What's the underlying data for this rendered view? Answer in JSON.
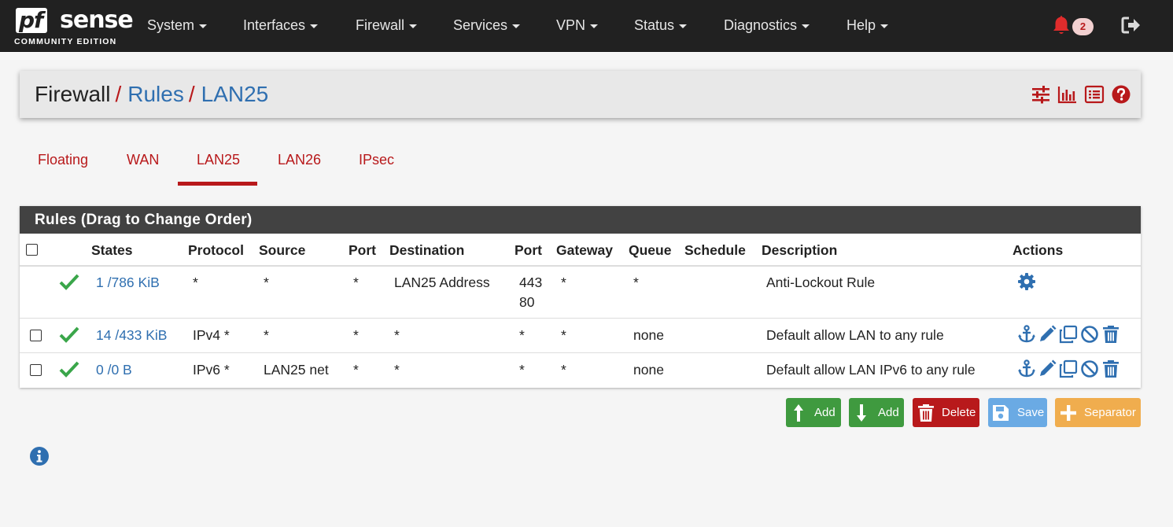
{
  "brand": {
    "logo_pf": "pf",
    "logo_sense": "sense",
    "edition": "COMMUNITY EDITION"
  },
  "nav": {
    "items": [
      {
        "label": "System"
      },
      {
        "label": "Interfaces"
      },
      {
        "label": "Firewall"
      },
      {
        "label": "Services"
      },
      {
        "label": "VPN"
      },
      {
        "label": "Status"
      },
      {
        "label": "Diagnostics"
      },
      {
        "label": "Help"
      }
    ],
    "notifications_count": "2",
    "icons": {
      "bell": "bell-icon",
      "logout": "sign-out-icon"
    },
    "colors": {
      "bar": "#212121",
      "alert": "#e02c2c"
    }
  },
  "breadcrumb": {
    "root": "Firewall",
    "sep": "/",
    "level1": "Rules",
    "level2": "LAN25",
    "icons": [
      "sliders-icon",
      "bar-chart-icon",
      "list-icon",
      "help-icon"
    ]
  },
  "tabs": [
    {
      "label": "Floating"
    },
    {
      "label": "WAN"
    },
    {
      "label": "LAN25",
      "active": true
    },
    {
      "label": "LAN26"
    },
    {
      "label": "IPsec"
    }
  ],
  "rules": {
    "panel_title": "Rules (Drag to Change Order)",
    "columns": [
      "States",
      "Protocol",
      "Source",
      "Port",
      "Destination",
      "Port",
      "Gateway",
      "Queue",
      "Schedule",
      "Description",
      "Actions"
    ],
    "rows": [
      {
        "states": "1 /786 KiB",
        "protocol": "*",
        "source": "*",
        "source_port": "*",
        "destination": "LAN25 Address",
        "dest_port_1": "443",
        "dest_port_2": "80",
        "gateway": "*",
        "queue": "*",
        "schedule": "",
        "description": "Anti-Lockout Rule",
        "actions": [
          "gear-icon"
        ]
      },
      {
        "states": "14 /433 KiB",
        "protocol": "IPv4 *",
        "source": "*",
        "source_port": "*",
        "destination": "*",
        "dest_port_1": "*",
        "gateway": "*",
        "queue": "none",
        "schedule": "",
        "description": "Default allow LAN to any rule",
        "actions": [
          "anchor-icon",
          "pencil-icon",
          "copy-icon",
          "ban-icon",
          "trash-icon"
        ]
      },
      {
        "states": "0 /0 B",
        "protocol": "IPv6 *",
        "source": "LAN25 net",
        "source_port": "*",
        "destination": "*",
        "dest_port_1": "*",
        "gateway": "*",
        "queue": "none",
        "schedule": "",
        "description": "Default allow LAN IPv6 to any rule",
        "actions": [
          "anchor-icon",
          "pencil-icon",
          "copy-icon",
          "ban-icon",
          "trash-icon"
        ]
      }
    ]
  },
  "buttons": {
    "add_top": "Add",
    "add_bottom": "Add",
    "delete": "Delete",
    "save": "Save",
    "separator": "Separator",
    "colors": {
      "add": "#3f9a3f",
      "delete": "#b8191b",
      "save": "#6aaae4",
      "separator": "#f0ad4e"
    }
  },
  "colors": {
    "accent_red": "#b8191b",
    "link_blue": "#2f6fb0",
    "check_green": "#3aa64a",
    "action_blue": "#2f6fb0"
  }
}
